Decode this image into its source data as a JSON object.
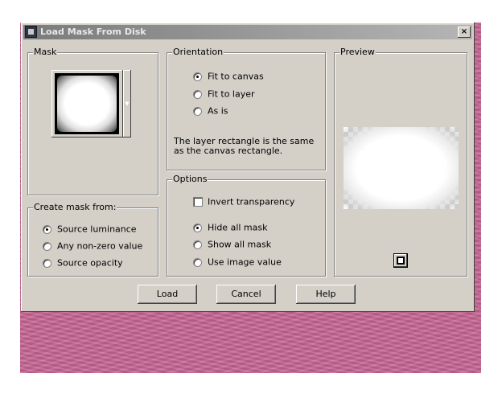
{
  "window": {
    "title": "Load Mask From Disk",
    "close_glyph": "×"
  },
  "mask": {
    "label": "Mask",
    "dropdown_glyph": "▼"
  },
  "create_mask": {
    "label": "Create mask from:",
    "options": [
      "Source luminance",
      "Any non-zero value",
      "Source opacity"
    ],
    "selected": "Source luminance"
  },
  "orientation": {
    "label": "Orientation",
    "options": [
      "Fit to canvas",
      "Fit to layer",
      "As is"
    ],
    "selected": "Fit to canvas",
    "description": "The layer rectangle is the same as the canvas rectangle."
  },
  "options": {
    "label": "Options",
    "invert_transparency": "Invert transparency",
    "invert_checked": false,
    "radios": [
      "Hide all mask",
      "Show all mask",
      "Use image value"
    ],
    "selected": "Hide all mask"
  },
  "preview": {
    "label": "Preview"
  },
  "buttons": {
    "load": "Load",
    "cancel": "Cancel",
    "help": "Help"
  },
  "colors": {
    "dialog_bg": "#d4d0c8",
    "titlebar": "#7b7b7b",
    "desktop": "#c76593"
  }
}
